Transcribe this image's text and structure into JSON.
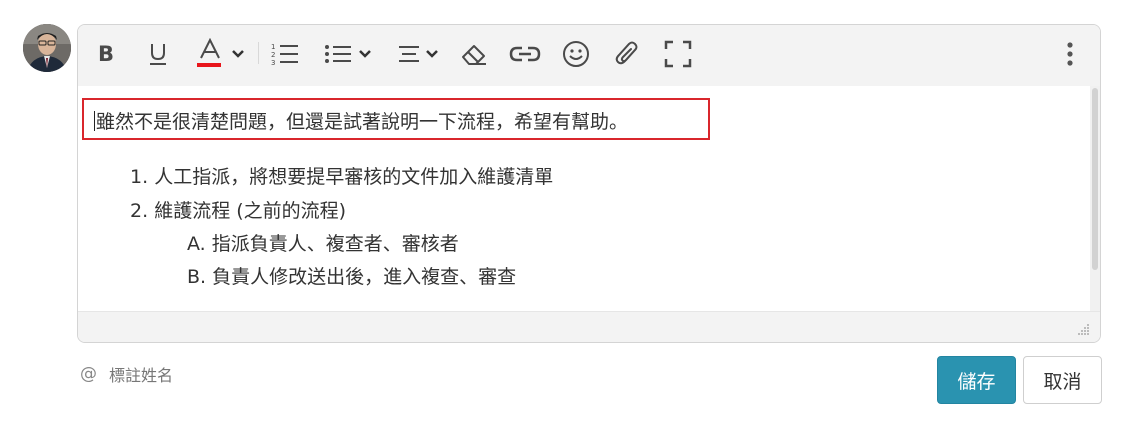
{
  "editor": {
    "content": {
      "first_line": "雖然不是很清楚問題，但還是試著說明一下流程，希望有幫助。",
      "items": [
        {
          "marker": "1.",
          "text": "人工指派，將想要提早審核的文件加入維護清單"
        },
        {
          "marker": "2.",
          "text": "維護流程 (之前的流程)"
        }
      ],
      "sub_items": [
        {
          "marker": "A.",
          "text": "指派負責人、複查者、審核者"
        },
        {
          "marker": "B.",
          "text": "負責人修改送出後，進入複查、審查"
        }
      ]
    },
    "colors": {
      "font_color_underline": "#e8151b",
      "highlight_border": "#d9262c"
    }
  },
  "mention": {
    "at_symbol": "@",
    "placeholder": "標註姓名"
  },
  "actions": {
    "save_label": "儲存",
    "cancel_label": "取消",
    "save_color": "#2a93b0"
  }
}
